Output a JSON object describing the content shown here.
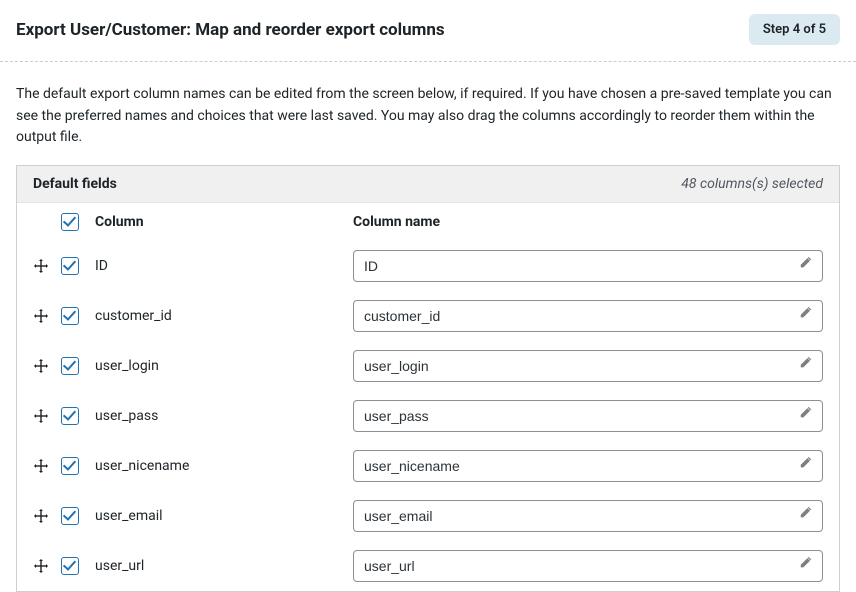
{
  "header": {
    "title": "Export User/Customer: Map and reorder export columns",
    "step_badge": "Step 4 of 5"
  },
  "description": "The default export column names can be edited from the screen below, if required. If you have chosen a pre-saved template you can see the preferred names and choices that were last saved. You may also drag the columns accordingly to reorder them within the output file.",
  "section": {
    "title": "Default fields",
    "count_text": "48 columns(s) selected"
  },
  "table": {
    "header_column": "Column",
    "header_column_name": "Column name"
  },
  "rows": [
    {
      "label": "ID",
      "value": "ID",
      "checked": true
    },
    {
      "label": "customer_id",
      "value": "customer_id",
      "checked": true
    },
    {
      "label": "user_login",
      "value": "user_login",
      "checked": true
    },
    {
      "label": "user_pass",
      "value": "user_pass",
      "checked": true
    },
    {
      "label": "user_nicename",
      "value": "user_nicename",
      "checked": true
    },
    {
      "label": "user_email",
      "value": "user_email",
      "checked": true
    },
    {
      "label": "user_url",
      "value": "user_url",
      "checked": true
    }
  ]
}
